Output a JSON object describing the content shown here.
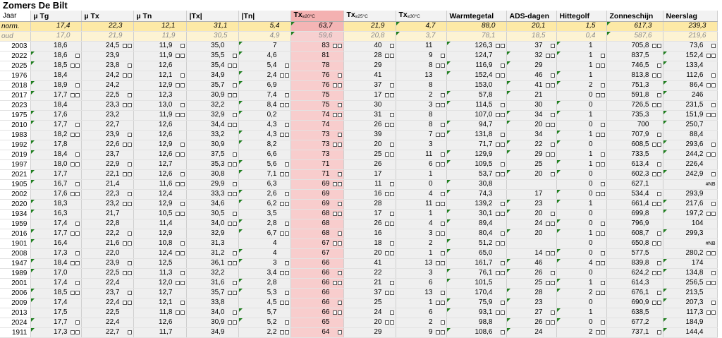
{
  "title": "Zomers De Bilt",
  "headers": [
    "Jaar",
    "µ Tg",
    "µ Tx",
    "µ Tn",
    "|Tx|",
    "|Tn|",
    "Tx≥20°C",
    "Tx≥25°C",
    "Tx≥30°C",
    "Warmtegetal",
    "ADS-dagen",
    "Hittegolf",
    "Zonneschijn",
    "Neerslag"
  ],
  "colors": {
    "header_bg": "#f2f2f2",
    "highlight_column": "#f8cdcd",
    "highlight_header": "#f4b1b1",
    "norm_row": "#fde9a6",
    "oud_row": "#fdf3d3",
    "data_cell": "#efefef",
    "comment_marker": "#1f7f1f"
  },
  "rows": [
    {
      "label": "norm.",
      "values": [
        "17,4",
        "22,3",
        "12,1",
        "31,1",
        "5,4",
        "63,7",
        "21,9",
        "4,7",
        "88,0",
        "20,1",
        "1,5",
        "617,3",
        "239,3"
      ]
    },
    {
      "label": "oud",
      "values": [
        "17,0",
        "21,9",
        "11,9",
        "30,5",
        "4,9",
        "59,6",
        "20,8",
        "3,7",
        "78,1",
        "18,5",
        "0,4",
        "587,6",
        "219,6"
      ]
    },
    {
      "label": "2003",
      "values": [
        "18,6",
        "24,5",
        "11,9",
        "35,0",
        "7",
        "83",
        "40",
        "11",
        "126,3",
        "37",
        "1",
        "705,8",
        "73,6"
      ]
    },
    {
      "label": "2022",
      "values": [
        "18,6",
        "23,9",
        "11,9",
        "35,5",
        "4,6",
        "81",
        "28",
        "9",
        "124,7",
        "32",
        "1",
        "837,5",
        "152,4"
      ]
    },
    {
      "label": "2025",
      "values": [
        "18,5",
        "23,8",
        "12,6",
        "35,4",
        "5,4",
        "78",
        "29",
        "8",
        "116,9",
        "29",
        "1",
        "746,5",
        "133,4"
      ]
    },
    {
      "label": "1976",
      "values": [
        "18,4",
        "24,2",
        "12,1",
        "34,9",
        "2,4",
        "76",
        "41",
        "13",
        "152,4",
        "46",
        "1",
        "813,8",
        "112,6"
      ]
    },
    {
      "label": "2018",
      "values": [
        "18,9",
        "24,2",
        "12,9",
        "35,7",
        "6,9",
        "76",
        "37",
        "8",
        "153,0",
        "41",
        "2",
        "751,3",
        "86,4"
      ]
    },
    {
      "label": "2017",
      "values": [
        "17,7",
        "22,5",
        "12,3",
        "30,9",
        "7,4",
        "75",
        "17",
        "2",
        "57,8",
        "21",
        "0",
        "591,8",
        "246"
      ]
    },
    {
      "label": "2023",
      "values": [
        "18,4",
        "23,3",
        "13,0",
        "32,2",
        "8,4",
        "75",
        "30",
        "3",
        "114,5",
        "30",
        "0",
        "726,5",
        "231,5"
      ]
    },
    {
      "label": "1975",
      "values": [
        "17,6",
        "23,2",
        "11,9",
        "32,9",
        "0,2",
        "74",
        "31",
        "8",
        "107,0",
        "34",
        "1",
        "735,3",
        "151,9"
      ]
    },
    {
      "label": "2010",
      "values": [
        "17,7",
        "22,7",
        "12,6",
        "34,4",
        "4,3",
        "74",
        "26",
        "8",
        "94,7",
        "20",
        "0",
        "700",
        "250,7"
      ]
    },
    {
      "label": "1983",
      "values": [
        "18,2",
        "23,9",
        "12,6",
        "33,2",
        "4,3",
        "73",
        "39",
        "7",
        "131,8",
        "34",
        "1",
        "707,9",
        "88,4"
      ]
    },
    {
      "label": "1992",
      "values": [
        "17,8",
        "22,6",
        "12,9",
        "30,9",
        "8,2",
        "73",
        "20",
        "3",
        "71,7",
        "22",
        "0",
        "608,5",
        "293,6"
      ]
    },
    {
      "label": "2019",
      "values": [
        "18,4",
        "23,7",
        "12,6",
        "37,5",
        "6,6",
        "73",
        "25",
        "11",
        "129,9",
        "29",
        "1",
        "733,5",
        "244,2"
      ]
    },
    {
      "label": "1997",
      "values": [
        "18,0",
        "22,9",
        "12,7",
        "35,3",
        "5,6",
        "71",
        "26",
        "6",
        "109,5",
        "25",
        "1",
        "613,4",
        "226,4"
      ]
    },
    {
      "label": "2021",
      "values": [
        "17,7",
        "22,1",
        "12,6",
        "30,8",
        "7,1",
        "71",
        "17",
        "1",
        "53,7",
        "20",
        "0",
        "602,3",
        "242,9"
      ]
    },
    {
      "label": "1905",
      "values": [
        "16,7",
        "21,4",
        "11,6",
        "29,9",
        "6,3",
        "69",
        "11",
        "0",
        "30,8",
        "",
        "0",
        "627,1",
        ""
      ],
      "nb": true
    },
    {
      "label": "2002",
      "values": [
        "17,6",
        "22,3",
        "12,4",
        "33,3",
        "2,6",
        "69",
        "16",
        "4",
        "74,3",
        "17",
        "0",
        "534,4",
        "293,9"
      ]
    },
    {
      "label": "2020",
      "values": [
        "18,3",
        "23,2",
        "12,9",
        "34,6",
        "6,2",
        "69",
        "28",
        "11",
        "139,2",
        "23",
        "1",
        "661,4",
        "217,6"
      ]
    },
    {
      "label": "1934",
      "values": [
        "16,3",
        "21,7",
        "10,5",
        "30,5",
        "3,5",
        "68",
        "17",
        "1",
        "30,1",
        "20",
        "0",
        "699,8",
        "197,2"
      ]
    },
    {
      "label": "1959",
      "values": [
        "17,4",
        "22,8",
        "11,4",
        "34,0",
        "2,8",
        "68",
        "26",
        "4",
        "89,4",
        "24",
        "0",
        "796,9",
        "104"
      ]
    },
    {
      "label": "2016",
      "values": [
        "17,7",
        "22,2",
        "12,9",
        "32,9",
        "6,7",
        "68",
        "16",
        "3",
        "80,4",
        "20",
        "1",
        "608,7",
        "299,3"
      ]
    },
    {
      "label": "1901",
      "values": [
        "16,4",
        "21,6",
        "10,8",
        "31,3",
        "4",
        "67",
        "18",
        "2",
        "51,2",
        "",
        "0",
        "650,8",
        ""
      ],
      "nb": true
    },
    {
      "label": "2008",
      "values": [
        "17,3",
        "22,0",
        "12,4",
        "31,2",
        "4",
        "67",
        "20",
        "1",
        "65,0",
        "14",
        "0",
        "577,5",
        "280,2"
      ]
    },
    {
      "label": "1947",
      "values": [
        "18,4",
        "23,9",
        "12,5",
        "36,1",
        "3",
        "66",
        "41",
        "13",
        "161,7",
        "46",
        "4",
        "839,8",
        "174"
      ]
    },
    {
      "label": "1989",
      "values": [
        "17,0",
        "22,5",
        "11,3",
        "32,2",
        "3,4",
        "66",
        "22",
        "3",
        "76,1",
        "26",
        "0",
        "624,2",
        "134,8"
      ]
    },
    {
      "label": "2001",
      "values": [
        "17,4",
        "22,4",
        "12,0",
        "31,6",
        "2,8",
        "66",
        "21",
        "6",
        "101,5",
        "25",
        "1",
        "614,3",
        "256,5"
      ]
    },
    {
      "label": "2006",
      "values": [
        "18,5",
        "23,7",
        "12,7",
        "35,7",
        "5,3",
        "66",
        "37",
        "13",
        "170,4",
        "28",
        "2",
        "676,1",
        "213,5"
      ]
    },
    {
      "label": "2009",
      "values": [
        "17,4",
        "22,4",
        "12,1",
        "33,8",
        "4,5",
        "66",
        "25",
        "1",
        "75,9",
        "23",
        "0",
        "690,9",
        "207,3"
      ]
    },
    {
      "label": "2013",
      "values": [
        "17,5",
        "22,5",
        "11,8",
        "34,0",
        "5,7",
        "66",
        "24",
        "6",
        "93,1",
        "27",
        "1",
        "638,5",
        "117,3"
      ]
    },
    {
      "label": "2024",
      "values": [
        "17,7",
        "22,4",
        "12,6",
        "30,9",
        "5,2",
        "65",
        "20",
        "2",
        "98,8",
        "26",
        "0",
        "677,2",
        "184,9"
      ]
    },
    {
      "label": "1911",
      "values": [
        "17,3",
        "22,7",
        "11,7",
        "34,9",
        "2,2",
        "64",
        "29",
        "9",
        "108,6",
        "24",
        "2",
        "737,1",
        "144,4"
      ]
    }
  ],
  "nb_label": "#NB"
}
